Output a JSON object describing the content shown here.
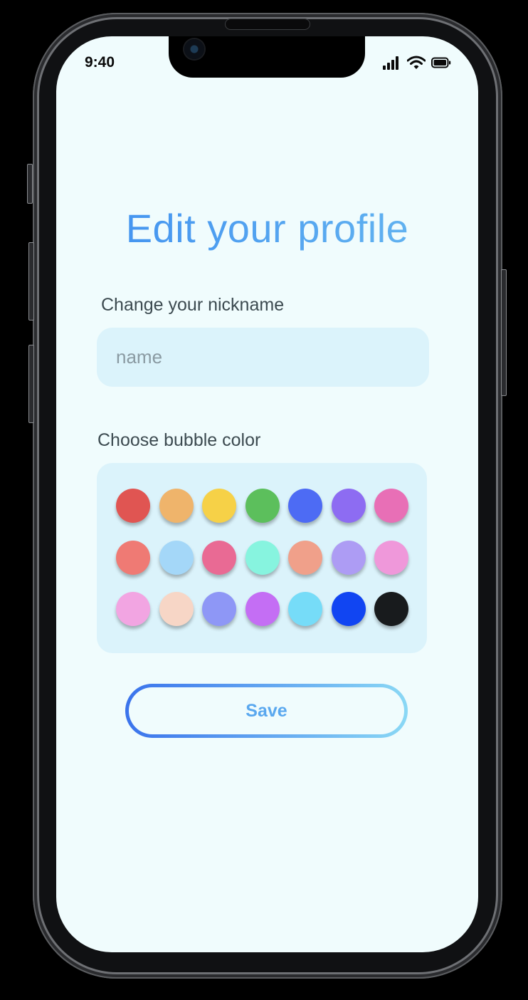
{
  "status_bar": {
    "time": "9:40",
    "icons": [
      "signal-icon",
      "wifi-icon",
      "battery-icon"
    ]
  },
  "page": {
    "title": "Edit your profile"
  },
  "nickname": {
    "label": "Change your nickname",
    "placeholder": "name",
    "value": ""
  },
  "bubble_color": {
    "label": "Choose bubble color",
    "colors": [
      "#e05552",
      "#efb46b",
      "#f6d147",
      "#5cbf5c",
      "#4d6bf4",
      "#8d6cf2",
      "#e86fb6",
      "#ef7a74",
      "#a4d7f8",
      "#e96a94",
      "#87f4df",
      "#f0a08a",
      "#ad9cf4",
      "#ef98da",
      "#f2a5e2",
      "#f7d6c6",
      "#8e97f6",
      "#c46ef4",
      "#76dcf8",
      "#1145f2",
      "#181b1d"
    ]
  },
  "actions": {
    "save_label": "Save"
  },
  "theme": {
    "screen_bg": "#f0fcfd",
    "field_bg": "#dbf3fb",
    "accent": "#4d9ff2"
  }
}
